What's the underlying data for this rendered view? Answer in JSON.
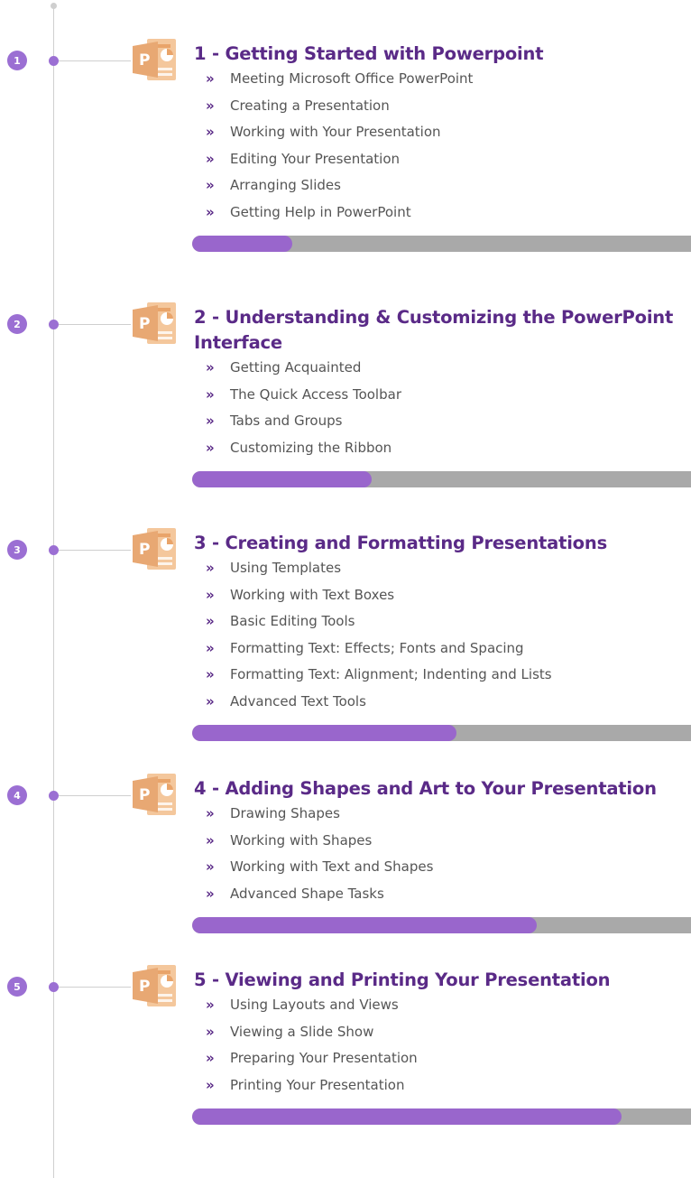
{
  "colors": {
    "accent": "#9b6fd3",
    "title": "#5a2a87",
    "progress_fill": "#9966cc",
    "progress_track": "#a9a9a9",
    "icon": "#e8a873"
  },
  "modules": [
    {
      "number": "1",
      "title": "1 - Getting Started with Powerpoint",
      "icon": "powerpoint-icon",
      "lessons": [
        "Meeting Microsoft Office PowerPoint",
        "Creating a Presentation",
        "Working with Your Presentation",
        "Editing Your Presentation",
        "Arranging Slides",
        "Getting Help in PowerPoint"
      ],
      "progress": 0.2
    },
    {
      "number": "2",
      "title": "2 - Understanding & Customizing the PowerPoint Interface",
      "icon": "powerpoint-icon",
      "lessons": [
        "Getting Acquainted",
        "The Quick Access Toolbar",
        "Tabs and Groups",
        "Customizing the Ribbon"
      ],
      "progress": 0.36
    },
    {
      "number": "3",
      "title": "3 - Creating and Formatting Presentations",
      "icon": "powerpoint-icon",
      "lessons": [
        "Using Templates",
        "Working with Text Boxes",
        "Basic Editing Tools",
        "Formatting Text: Effects; Fonts and Spacing",
        "Formatting Text: Alignment; Indenting and Lists",
        "Advanced Text Tools"
      ],
      "progress": 0.53
    },
    {
      "number": "4",
      "title": "4 - Adding Shapes and Art to Your Presentation",
      "icon": "powerpoint-icon",
      "lessons": [
        "Drawing Shapes",
        "Working with Shapes",
        "Working with Text and Shapes",
        "Advanced Shape Tasks"
      ],
      "progress": 0.69
    },
    {
      "number": "5",
      "title": "5 - Viewing and Printing Your Presentation",
      "icon": "powerpoint-icon",
      "lessons": [
        "Using Layouts and Views",
        "Viewing a Slide Show",
        "Preparing Your Presentation",
        "Printing Your Presentation"
      ],
      "progress": 0.86
    }
  ]
}
